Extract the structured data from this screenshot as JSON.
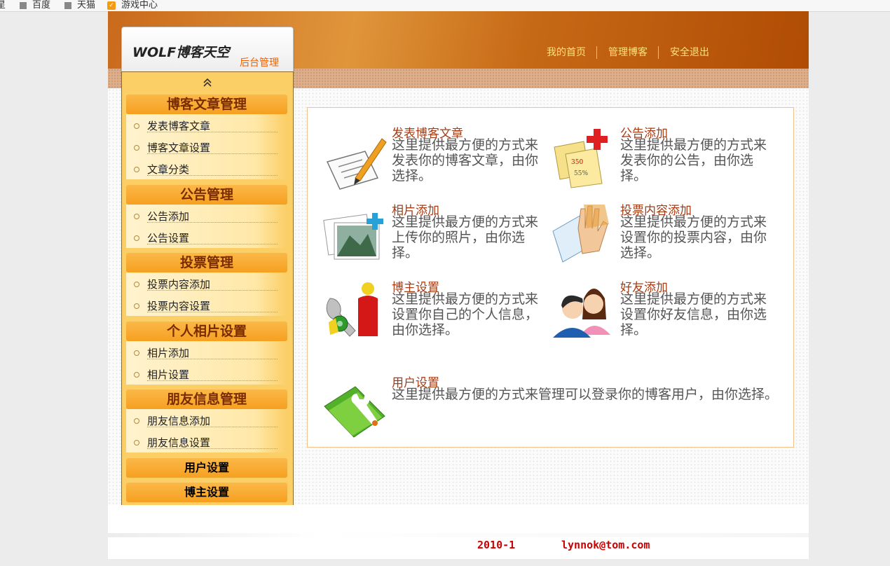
{
  "bookmarks": [
    {
      "label": "星",
      "icon": "bookmark-icon"
    },
    {
      "label": "百度",
      "icon": "bookmark-icon"
    },
    {
      "label": "天猫",
      "icon": "bookmark-icon"
    },
    {
      "label": "游戏中心",
      "icon": "game-center-icon"
    }
  ],
  "logo": {
    "main": "WOLF博客天空",
    "sub": "后台管理"
  },
  "nav": {
    "home": "我的首页",
    "manage": "管理博客",
    "logout": "安全退出"
  },
  "sidebar": {
    "sections": [
      {
        "title": "博客文章管理",
        "items": [
          "发表博客文章",
          "博客文章设置",
          "文章分类"
        ]
      },
      {
        "title": "公告管理",
        "items": [
          "公告添加",
          "公告设置"
        ]
      },
      {
        "title": "投票管理",
        "items": [
          "投票内容添加",
          "投票内容设置"
        ]
      },
      {
        "title": "个人相片设置",
        "items": [
          "相片添加",
          "相片设置"
        ]
      },
      {
        "title": "朋友信息管理",
        "items": [
          "朋友信息添加",
          "朋友信息设置"
        ]
      }
    ],
    "user_settings": "用户设置",
    "blogger_settings": "博主设置"
  },
  "cards": [
    {
      "title": "发表博客文章",
      "lines": [
        "这里提供最方便的方式来",
        "发表你的博客文章，由你",
        "选择。"
      ],
      "icon": "pen-paper-icon"
    },
    {
      "title": "公告添加",
      "lines": [
        "这里提供最方便的方式来",
        "发表你的公告，由你选",
        "择。"
      ],
      "icon": "notes-add-icon"
    },
    {
      "title": "相片添加",
      "lines": [
        "这里提供最方便的方式来",
        "上传你的照片，由你选",
        "择。"
      ],
      "icon": "photos-add-icon"
    },
    {
      "title": "投票内容添加",
      "lines": [
        "这里提供最方便的方式来",
        "设置你的投票内容，由你",
        "选择。"
      ],
      "icon": "hand-vote-icon"
    },
    {
      "title": "博主设置",
      "lines": [
        "这里提供最方便的方式来",
        "设置你自己的个人信息，",
        "由你选择。"
      ],
      "icon": "settings-user-icon"
    },
    {
      "title": "好友添加",
      "lines": [
        "这里提供最方便的方式来",
        "设置你好友信息，由你选",
        "择。"
      ],
      "icon": "friends-icon"
    },
    {
      "title": "用户设置",
      "lines": [
        "这里提供最方便的方式来管理可以登录你的博客用户，由你选择。"
      ],
      "icon": "folder-settings-icon"
    }
  ],
  "footer": {
    "date": "2010-1",
    "email": "lynnok@tom.com"
  }
}
